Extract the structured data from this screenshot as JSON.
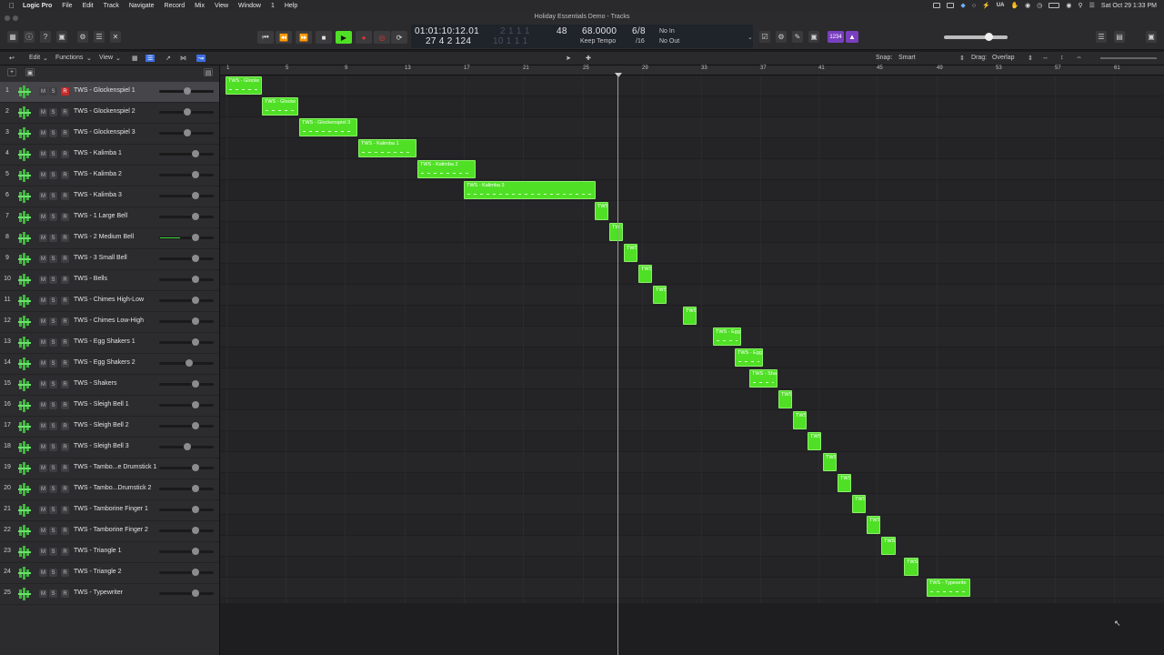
{
  "menubar": {
    "app": "Logic Pro",
    "items": [
      "File",
      "Edit",
      "Track",
      "Navigate",
      "Record",
      "Mix",
      "View",
      "Window",
      "1",
      "Help"
    ],
    "ua": "UA",
    "clock": "Sat Oct 29  1:33 PM"
  },
  "window": {
    "title": "Holiday Essentials Demo - Tracks"
  },
  "lcd": {
    "time": "01:01:10:12.01",
    "bars": "27  4  2  124",
    "dim_top": "2  1  1  1",
    "dim_bottom": "10  1  1  1",
    "bpm_div": "48",
    "tempo": "68.0000",
    "tempo_mode": "Keep Tempo",
    "sig_top": "6/8",
    "sig_bottom": "/16",
    "in": "No In",
    "out": "No Out"
  },
  "controlbar": {
    "lcd_mode_label": "1234"
  },
  "trackbar": {
    "edit": "Edit",
    "functions": "Functions",
    "view": "View",
    "snap_label": "Snap:",
    "snap_value": "Smart",
    "drag_label": "Drag:",
    "drag_value": "Overlap"
  },
  "ruler": {
    "marks": [
      "1",
      "5",
      "9",
      "13",
      "17",
      "21",
      "25",
      "29",
      "33",
      "37",
      "41",
      "45",
      "49",
      "53",
      "57",
      "61"
    ]
  },
  "tracks": [
    {
      "num": "1",
      "name": "TWS - Glockenspiel 1",
      "region": "TWS - Glocke",
      "fader": 0.52
    },
    {
      "num": "2",
      "name": "TWS - Glockenspiel 2",
      "region": "TWS - Glocke",
      "fader": 0.52
    },
    {
      "num": "3",
      "name": "TWS - Glockenspiel 3",
      "region": "TWS - Glockenspiel 3",
      "fader": 0.52
    },
    {
      "num": "4",
      "name": "TWS - Kalimba 1",
      "region": "TWS - Kalimba 1",
      "fader": 0.7
    },
    {
      "num": "5",
      "name": "TWS - Kalimba 2",
      "region": "TWS - Kalimba 2",
      "fader": 0.7
    },
    {
      "num": "6",
      "name": "TWS - Kalimba 3",
      "region": "TWS - Kalimba 3",
      "fader": 0.7
    },
    {
      "num": "7",
      "name": "TWS - 1 Large Bell",
      "region": "TWS",
      "fader": 0.7
    },
    {
      "num": "8",
      "name": "TWS - 2 Medium Bell",
      "region": "TW S",
      "fader": 0.7
    },
    {
      "num": "9",
      "name": "TWS - 3 Small Bell",
      "region": "TWS",
      "fader": 0.7
    },
    {
      "num": "10",
      "name": "TWS - Bells",
      "region": "TWS",
      "fader": 0.7
    },
    {
      "num": "11",
      "name": "TWS - Chimes High-Low",
      "region": "TWS",
      "fader": 0.7
    },
    {
      "num": "12",
      "name": "TWS - Chimes Low-High",
      "region": "TWS",
      "fader": 0.7
    },
    {
      "num": "13",
      "name": "TWS - Egg Shakers 1",
      "region": "TWS - Egg",
      "fader": 0.7
    },
    {
      "num": "14",
      "name": "TWS - Egg Shakers 2",
      "region": "TWS - Egg",
      "fader": 0.55
    },
    {
      "num": "15",
      "name": "TWS - Shakers",
      "region": "TWS - Sha",
      "fader": 0.7
    },
    {
      "num": "16",
      "name": "TWS - Sleigh Bell 1",
      "region": "TWS",
      "fader": 0.7
    },
    {
      "num": "17",
      "name": "TWS - Sleigh Bell 2",
      "region": "TWS",
      "fader": 0.7
    },
    {
      "num": "18",
      "name": "TWS - Sleigh Bell 3",
      "region": "TWS",
      "fader": 0.52
    },
    {
      "num": "19",
      "name": "TWS - Tambo...e Drumstick 1",
      "region": "TWS",
      "fader": 0.7
    },
    {
      "num": "20",
      "name": "TWS - Tambo...Drumstick 2",
      "region": "TWS",
      "fader": 0.7
    },
    {
      "num": "21",
      "name": "TWS - Tamborine Finger 1",
      "region": "TWS",
      "fader": 0.7
    },
    {
      "num": "22",
      "name": "TWS - Tamborine Finger 2",
      "region": "TWS",
      "fader": 0.7
    },
    {
      "num": "23",
      "name": "TWS - Triangle 1",
      "region": "TWS",
      "fader": 0.7
    },
    {
      "num": "24",
      "name": "TWS - Triangle 2",
      "region": "TWS",
      "fader": 0.7
    },
    {
      "num": "25",
      "name": "TWS - Typewriter",
      "region": "TWS - Typewrite",
      "fader": 0.7
    }
  ],
  "colors": {
    "region": "#4fe025",
    "record": "#c8282a",
    "play": "#4fe025"
  }
}
